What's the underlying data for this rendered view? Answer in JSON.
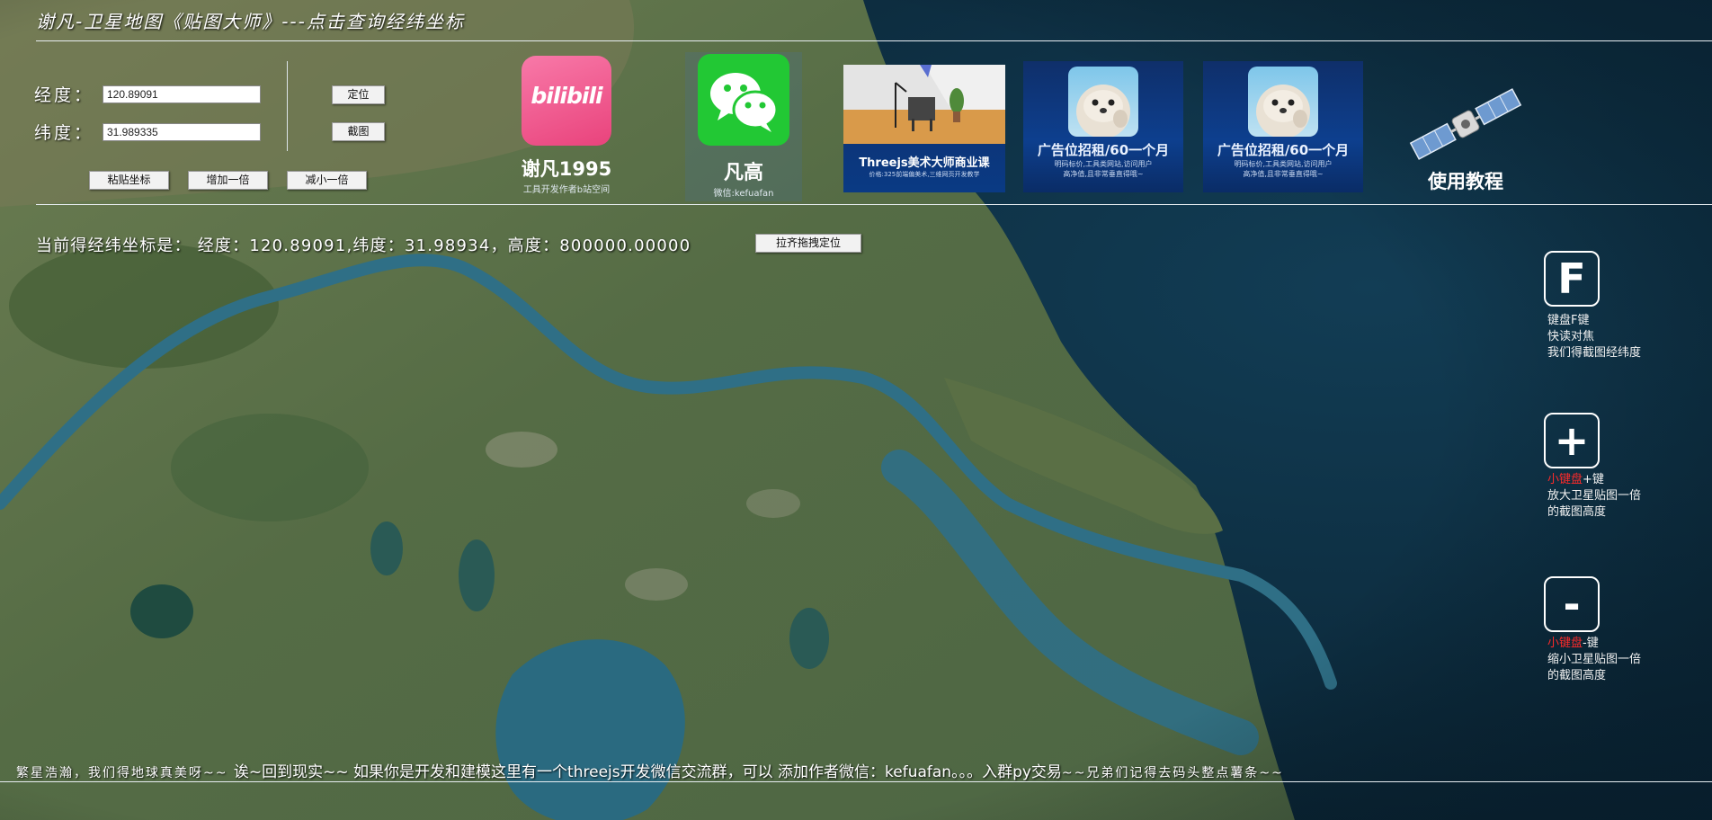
{
  "header": {
    "title": "谢凡-卫星地图《贴图大师》---点击查询经纬坐标"
  },
  "form": {
    "lon_label": "经度：",
    "lon_value": "120.89091",
    "lat_label": "纬度：",
    "lat_value": "31.989335",
    "locate_button": "定位",
    "screenshot_button": "截图",
    "paste_button": "粘贴坐标",
    "double_button": "增加一倍",
    "halve_button": "减小一倍"
  },
  "ads": {
    "bili_logo": "bilibili",
    "bili_name": "谢凡1995",
    "bili_sub": "工具开发作者b站空间",
    "wechat_name": "凡高",
    "wechat_sub": "微信:kefuafan",
    "course_title": "Threejs美术大师商业课",
    "course_sub": "价格:325前端偏美术,三维网页开发教学",
    "ad1_title": "广告位招租/60一个月",
    "ad1_sub1": "明码标价,工具类网站,访问用户",
    "ad1_sub2": "高净值,且非常垂直得哦~",
    "ad2_title": "广告位招租/60一个月",
    "ad2_sub1": "明码标价,工具类网站,访问用户",
    "ad2_sub2": "高净值,且非常垂直得哦~",
    "tutorial": "使用教程"
  },
  "status": {
    "coord_text": "当前得经纬坐标是：  经度：120.89091,纬度：31.98934，高度：800000.00000",
    "drag_button": "拉齐拖拽定位"
  },
  "keys": {
    "f_key": "F",
    "f_line1": "键盘F键",
    "f_line2": "快读对焦",
    "f_line3": "我们得截图经纬度",
    "plus_key": "+",
    "plus_red": "小键盘",
    "plus_line1_rest": "+键",
    "plus_line2": "放大卫星贴图一倍",
    "plus_line3": "的截图高度",
    "minus_key": "-",
    "minus_red": "小键盘",
    "minus_line1_rest": "-键",
    "minus_line2": "缩小卫星贴图一倍",
    "minus_line3": "的截图高度"
  },
  "footer": {
    "part1": "繁星浩瀚，我们得地球真美呀~~ ",
    "part2": "诶~回到现实~~ 如果你是开发和建模这里有一个threejs开发微信交流群，可以 添加作者微信：kefuafan。。。入群py交易",
    "part3": "~~兄弟们记得去码头整点薯条~~"
  },
  "colors": {
    "ocean": "#0b2a3e",
    "land": "#5b7048",
    "water": "#2a6a80",
    "bili_pink": "#ef5a90",
    "wechat_green": "#22c834",
    "accent_red": "#ff2a2a"
  },
  "icons": [
    "bilibili-logo",
    "wechat-logo",
    "satellite-icon",
    "seal-photo"
  ]
}
